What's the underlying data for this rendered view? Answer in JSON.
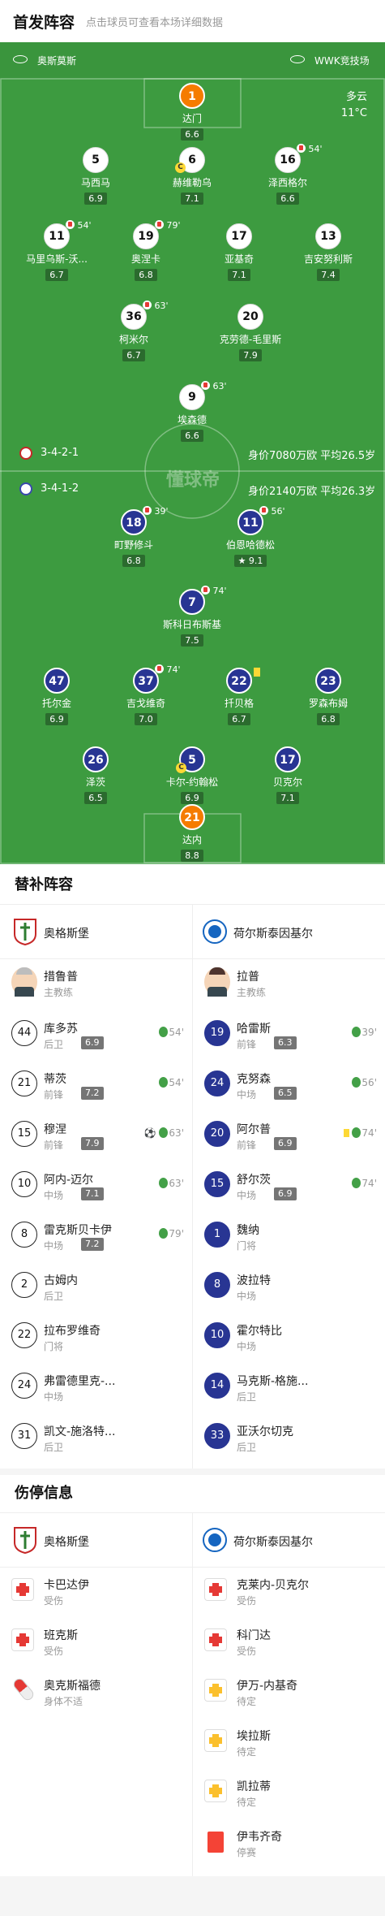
{
  "header": {
    "title": "首发阵容",
    "subtitle": "点击球员可查看本场详细数据"
  },
  "pitch": {
    "home_team": "奥斯莫斯",
    "away_team": "WWK竞技场",
    "weather": "多云",
    "temperature": "11°C",
    "watermark": "懂球帝",
    "home_formation": "3-4-2-1",
    "home_value": "身价7080万欧 平均26.5岁",
    "away_formation": "3-4-1-2",
    "away_value": "身价2140万欧 平均26.3岁",
    "home_players": [
      {
        "num": "1",
        "name": "达门",
        "rating": "6.6"
      },
      {
        "num": "5",
        "name": "马西马",
        "rating": "6.9"
      },
      {
        "num": "6",
        "name": "赫维勒乌",
        "rating": "7.1"
      },
      {
        "num": "16",
        "name": "泽西格尔",
        "rating": "6.6",
        "sub": "54'"
      },
      {
        "num": "11",
        "name": "马里乌斯-沃...",
        "rating": "6.7",
        "sub": "54'"
      },
      {
        "num": "19",
        "name": "奥涅卡",
        "rating": "6.8",
        "sub": "79'"
      },
      {
        "num": "17",
        "name": "亚基奇",
        "rating": "7.1"
      },
      {
        "num": "13",
        "name": "吉安努利斯",
        "rating": "7.4"
      },
      {
        "num": "36",
        "name": "柯米尔",
        "rating": "6.7",
        "sub": "63'"
      },
      {
        "num": "20",
        "name": "克劳德-毛里斯",
        "rating": "7.9"
      },
      {
        "num": "9",
        "name": "埃森德",
        "rating": "6.6",
        "sub": "63'"
      }
    ],
    "away_players": [
      {
        "num": "18",
        "name": "町野修斗",
        "rating": "6.8",
        "sub": "39'"
      },
      {
        "num": "11",
        "name": "伯恩哈德松",
        "rating": "9.1",
        "sub": "56'"
      },
      {
        "num": "7",
        "name": "斯科日布斯基",
        "rating": "7.5",
        "sub": "74'"
      },
      {
        "num": "47",
        "name": "托尔金",
        "rating": "6.9"
      },
      {
        "num": "37",
        "name": "吉戈维奇",
        "rating": "7.0",
        "sub": "74'"
      },
      {
        "num": "22",
        "name": "扦贝格",
        "rating": "6.7"
      },
      {
        "num": "23",
        "name": "罗森布姆",
        "rating": "6.8"
      },
      {
        "num": "26",
        "name": "泽茨",
        "rating": "6.5"
      },
      {
        "num": "5",
        "name": "卡尔-约翰松",
        "rating": "6.9"
      },
      {
        "num": "17",
        "name": "贝克尔",
        "rating": "7.1"
      },
      {
        "num": "21",
        "name": "达内",
        "rating": "8.8"
      }
    ]
  },
  "subs": {
    "title": "替补阵容",
    "home_team": "奥格斯堡",
    "away_team": "荷尔斯泰因基尔",
    "home_coach": {
      "name": "措鲁普",
      "role": "主教练"
    },
    "away_coach": {
      "name": "拉普",
      "role": "主教练"
    },
    "home": [
      {
        "num": "44",
        "name": "库多苏",
        "pos": "后卫",
        "rating": "6.9",
        "min": "54'"
      },
      {
        "num": "21",
        "name": "蒂茨",
        "pos": "前锋",
        "rating": "7.2",
        "min": "54'"
      },
      {
        "num": "15",
        "name": "穆涅",
        "pos": "前锋",
        "rating": "7.9",
        "min": "63'"
      },
      {
        "num": "10",
        "name": "阿内-迈尔",
        "pos": "中场",
        "rating": "7.1",
        "min": "63'"
      },
      {
        "num": "8",
        "name": "雷克斯贝卡伊",
        "pos": "中场",
        "rating": "7.2",
        "min": "79'"
      },
      {
        "num": "2",
        "name": "古姆内",
        "pos": "后卫"
      },
      {
        "num": "22",
        "name": "拉布罗维奇",
        "pos": "门将"
      },
      {
        "num": "24",
        "name": "弗雷德里克-...",
        "pos": "中场"
      },
      {
        "num": "31",
        "name": "凯文-施洛特...",
        "pos": "后卫"
      }
    ],
    "away": [
      {
        "num": "19",
        "name": "哈雷斯",
        "pos": "前锋",
        "rating": "6.3",
        "min": "39'"
      },
      {
        "num": "24",
        "name": "克努森",
        "pos": "中场",
        "rating": "6.5",
        "min": "56'"
      },
      {
        "num": "20",
        "name": "阿尔普",
        "pos": "前锋",
        "rating": "6.9",
        "min": "74'"
      },
      {
        "num": "15",
        "name": "舒尔茨",
        "pos": "中场",
        "rating": "6.9",
        "min": "74'"
      },
      {
        "num": "1",
        "name": "魏纳",
        "pos": "门将"
      },
      {
        "num": "8",
        "name": "波拉特",
        "pos": "中场"
      },
      {
        "num": "10",
        "name": "霍尔特比",
        "pos": "中场"
      },
      {
        "num": "14",
        "name": "马克斯-格施...",
        "pos": "后卫"
      },
      {
        "num": "33",
        "name": "亚沃尔切克",
        "pos": "后卫"
      }
    ]
  },
  "injuries": {
    "title": "伤停信息",
    "home_team": "奥格斯堡",
    "away_team": "荷尔斯泰因基尔",
    "home": [
      {
        "name": "卡巴达伊",
        "status": "受伤"
      },
      {
        "name": "班克斯",
        "status": "受伤"
      },
      {
        "name": "奥克斯福德",
        "status": "身体不适"
      }
    ],
    "away": [
      {
        "name": "克莱内-贝克尔",
        "status": "受伤"
      },
      {
        "name": "科门达",
        "status": "受伤"
      },
      {
        "name": "伊万-内基奇",
        "status": "待定"
      },
      {
        "name": "埃拉斯",
        "status": "待定"
      },
      {
        "name": "凯拉蒂",
        "status": "待定"
      },
      {
        "name": "伊韦齐奇",
        "status": "停赛"
      }
    ]
  }
}
